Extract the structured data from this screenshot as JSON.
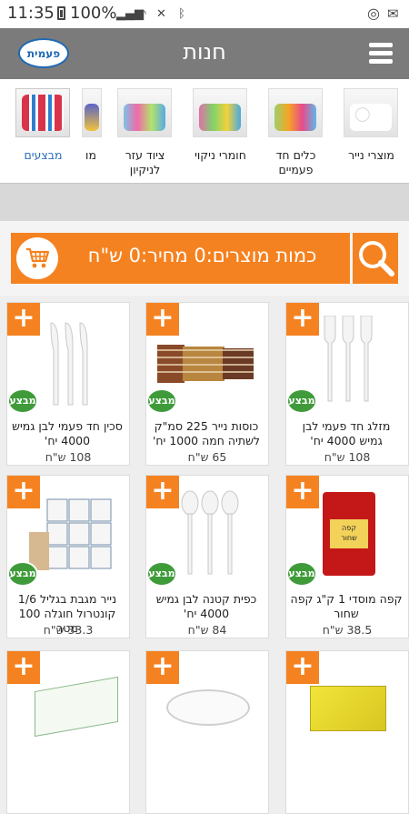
{
  "status": {
    "time": "11:35",
    "battery": "100%"
  },
  "header": {
    "title": "חנות",
    "logo_text": "פעמית"
  },
  "categories": [
    {
      "label": "מוצרי נייר",
      "color": "#e9e9ef"
    },
    {
      "label": "כלים חד\nפעמיים",
      "color": "#9bd06b"
    },
    {
      "label": "חומרי ניקוי",
      "color": "#e06fa8"
    },
    {
      "label": "ציוד עזר\nלניקיון",
      "color": "#7ec3e6"
    },
    {
      "label": "מו",
      "color": "#5b63c9"
    },
    {
      "label": "מבצעים",
      "color": "#d9334b"
    }
  ],
  "cart": {
    "summary": "כמות מוצרים:0 מחיר:0 ש\"ח"
  },
  "products": [
    {
      "name": "מזלג חד פעמי לבן גמיש 4000 יח'",
      "price": "108 ש\"ח",
      "badge": "מבצע"
    },
    {
      "name": "כוסות נייר 225 סמ\"ק לשתיה חמה 1000 יח'",
      "price": "65 ש\"ח",
      "badge": "מבצע"
    },
    {
      "name": "סכין חד פעמי לבן גמיש 4000 יח'",
      "price": "108 ש\"ח",
      "badge": "מבצע"
    },
    {
      "name": "קפה מוסדי 1 ק\"ג קפה שחור",
      "price": "38.5 ש\"ח",
      "badge": "מבצע"
    },
    {
      "name": "כפית קטנה לבן גמיש 4000 יח'",
      "price": "84 ש\"ח",
      "badge": "מבצע"
    },
    {
      "name": "נייר מגבת בגליל 1/6 קונטרול חוגלה 100 מטר",
      "price": "33.3 ש\"ח",
      "badge": "מבצע"
    },
    {
      "name": "",
      "price": "",
      "badge": ""
    },
    {
      "name": "",
      "price": "",
      "badge": ""
    },
    {
      "name": "",
      "price": "",
      "badge": ""
    }
  ],
  "coffee_label": "קפה\nשחור",
  "colors": {
    "accent": "#f58220",
    "sale": "#3f9b3a",
    "header": "#7b7b7b",
    "active": "#2a6db5"
  }
}
